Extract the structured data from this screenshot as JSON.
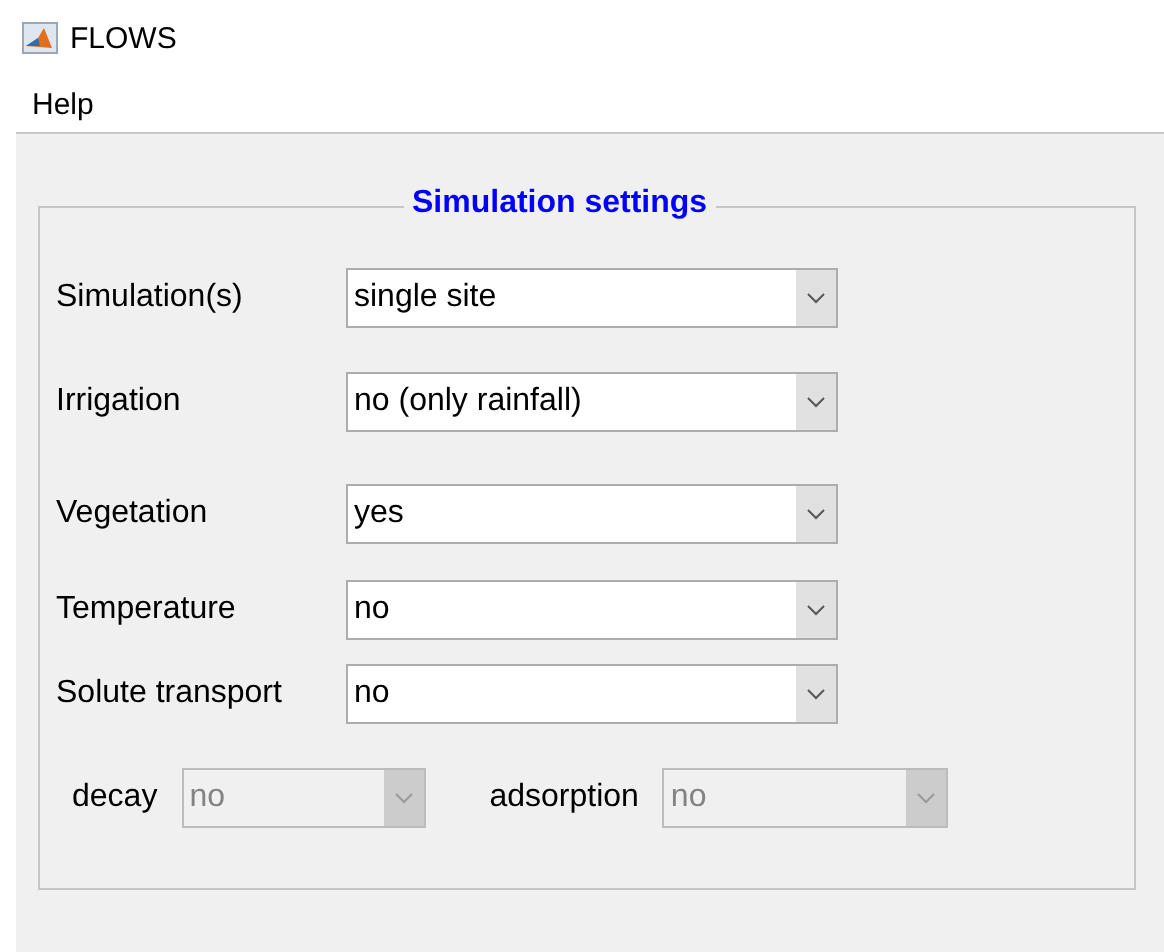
{
  "window": {
    "title": "FLOWS"
  },
  "menu": [
    "Help"
  ],
  "panel": {
    "title": "Simulation settings",
    "fields": [
      {
        "label": "Simulation(s)",
        "value": "single site",
        "disabled": false
      },
      {
        "label": "Irrigation",
        "value": "no (only rainfall)",
        "disabled": false
      },
      {
        "label": "Vegetation",
        "value": "yes",
        "disabled": false
      },
      {
        "label": "Temperature",
        "value": "no",
        "disabled": false
      },
      {
        "label": "Solute transport",
        "value": "no",
        "disabled": false
      }
    ],
    "sub_fields": [
      {
        "label": "decay",
        "value": "no",
        "disabled": true
      },
      {
        "label": "adsorption",
        "value": "no",
        "disabled": true
      }
    ]
  }
}
